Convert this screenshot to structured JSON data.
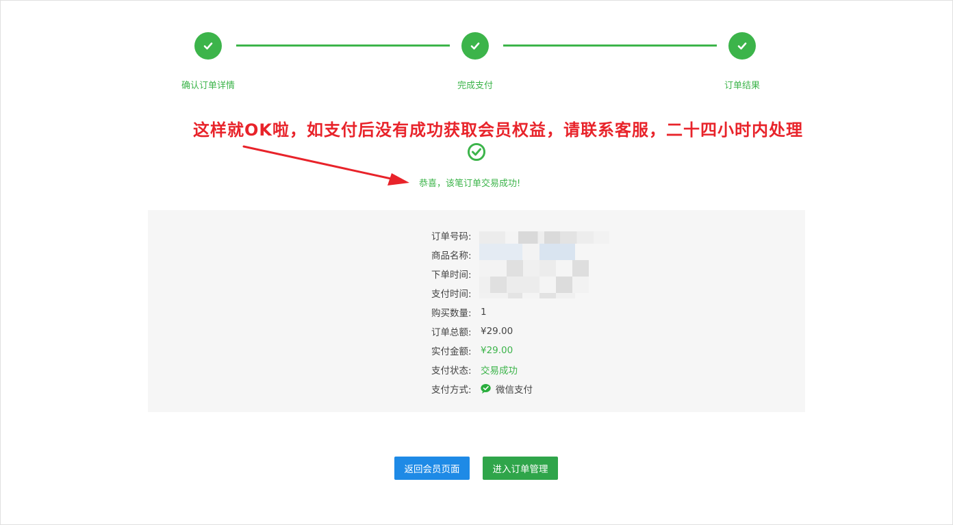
{
  "steps": [
    {
      "label": "确认订单详情"
    },
    {
      "label": "完成支付"
    },
    {
      "label": "订单结果"
    }
  ],
  "annotation": "这样就OK啦，如支付后没有成功获取会员权益，请联系客服，二十四小时内处理",
  "success_message": "恭喜，该笔订单交易成功!",
  "order": {
    "order_no_label": "订单号码:",
    "product_label": "商品名称:",
    "order_time_label": "下单时间:",
    "pay_time_label": "支付时间:",
    "quantity_label": "购买数量:",
    "quantity": "1",
    "total_label": "订单总额:",
    "total": "¥29.00",
    "paid_label": "实付金额:",
    "paid": "¥29.00",
    "status_label": "支付状态:",
    "status": "交易成功",
    "method_label": "支付方式:",
    "method": "微信支付"
  },
  "buttons": {
    "back": "返回会员页面",
    "orders": "进入订单管理"
  },
  "colors": {
    "success": "#3cb44a",
    "annotation": "#e8232a",
    "primary": "#1e8ae6",
    "green_button": "#2fa54a"
  }
}
